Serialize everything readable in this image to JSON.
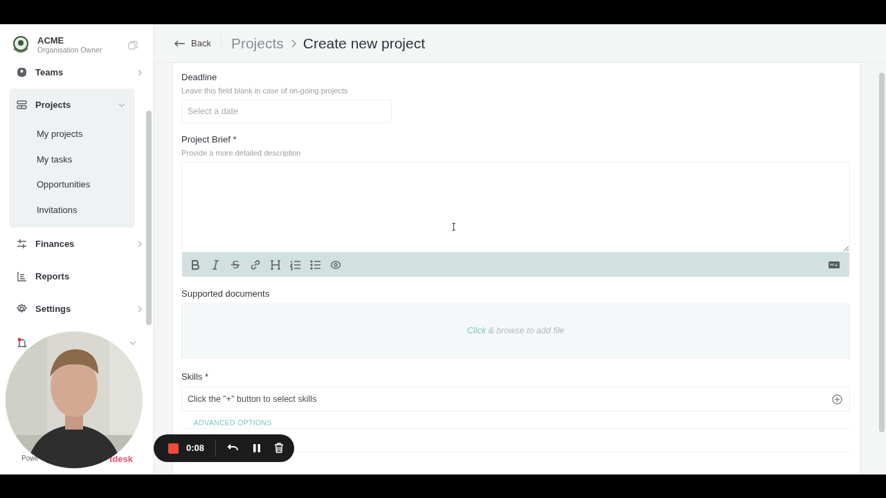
{
  "sidebar": {
    "org": {
      "name": "ACME",
      "role": "Organisation Owner"
    },
    "items": [
      {
        "label": "Teams",
        "expanded": false,
        "selected": false
      },
      {
        "label": "Projects",
        "expanded": true,
        "selected": true,
        "children": [
          {
            "label": "My projects"
          },
          {
            "label": "My tasks"
          },
          {
            "label": "Opportunities"
          },
          {
            "label": "Invitations"
          }
        ]
      },
      {
        "label": "Finances",
        "expanded": false,
        "selected": false
      },
      {
        "label": "Reports",
        "selected": false
      },
      {
        "label": "Settings",
        "expanded": false,
        "selected": false
      }
    ],
    "footer_left": "Powe",
    "footer_right": "tdesk"
  },
  "header": {
    "back": "Back",
    "breadcrumbs": [
      {
        "label": "Projects",
        "current": false
      },
      {
        "label": "Create new project",
        "current": true
      }
    ]
  },
  "form": {
    "deadline": {
      "label": "Deadline",
      "hint": "Leave this field blank in case of on-going projects",
      "placeholder": "Select a date"
    },
    "brief": {
      "label": "Project Brief *",
      "hint": "Provide a more detailed description"
    },
    "documents": {
      "label": "Supported documents",
      "link": "Click",
      "text": " & browse to add file"
    },
    "skills": {
      "label": "Skills *",
      "value": "Click the \"+\" button to select skills"
    },
    "advanced": "ADVANCED OPTIONS"
  },
  "recorder": {
    "time": "0:08"
  }
}
